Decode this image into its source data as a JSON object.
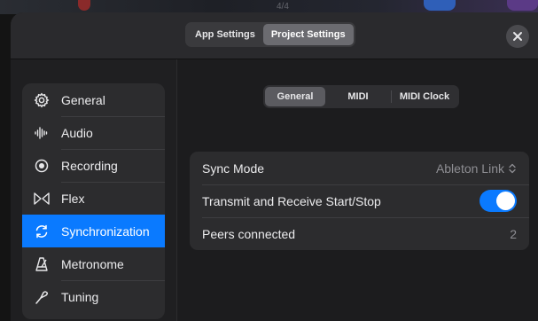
{
  "background": {
    "ghost_text": "4/4"
  },
  "header": {
    "tabs": [
      {
        "label": "App Settings",
        "active": false
      },
      {
        "label": "Project Settings",
        "active": true
      }
    ],
    "close_icon": "close-icon"
  },
  "sidebar": {
    "items": [
      {
        "label": "General",
        "icon": "gear-icon",
        "selected": false
      },
      {
        "label": "Audio",
        "icon": "waveform-icon",
        "selected": false
      },
      {
        "label": "Recording",
        "icon": "record-icon",
        "selected": false
      },
      {
        "label": "Flex",
        "icon": "flex-icon",
        "selected": false
      },
      {
        "label": "Synchronization",
        "icon": "sync-icon",
        "selected": true
      },
      {
        "label": "Metronome",
        "icon": "metronome-icon",
        "selected": false
      },
      {
        "label": "Tuning",
        "icon": "tuning-fork-icon",
        "selected": false
      }
    ]
  },
  "subtabs": [
    {
      "label": "General",
      "active": true
    },
    {
      "label": "MIDI",
      "active": false
    },
    {
      "label": "MIDI Clock",
      "active": false
    }
  ],
  "sync": {
    "sync_mode_label": "Sync Mode",
    "sync_mode_value": "Ableton Link",
    "transmit_label": "Transmit and Receive Start/Stop",
    "transmit_on": true,
    "peers_label": "Peers connected",
    "peers_value": "2"
  },
  "colors": {
    "accent": "#0a7aff",
    "panel": "#2c2c2e",
    "background": "#1c1c1e"
  }
}
